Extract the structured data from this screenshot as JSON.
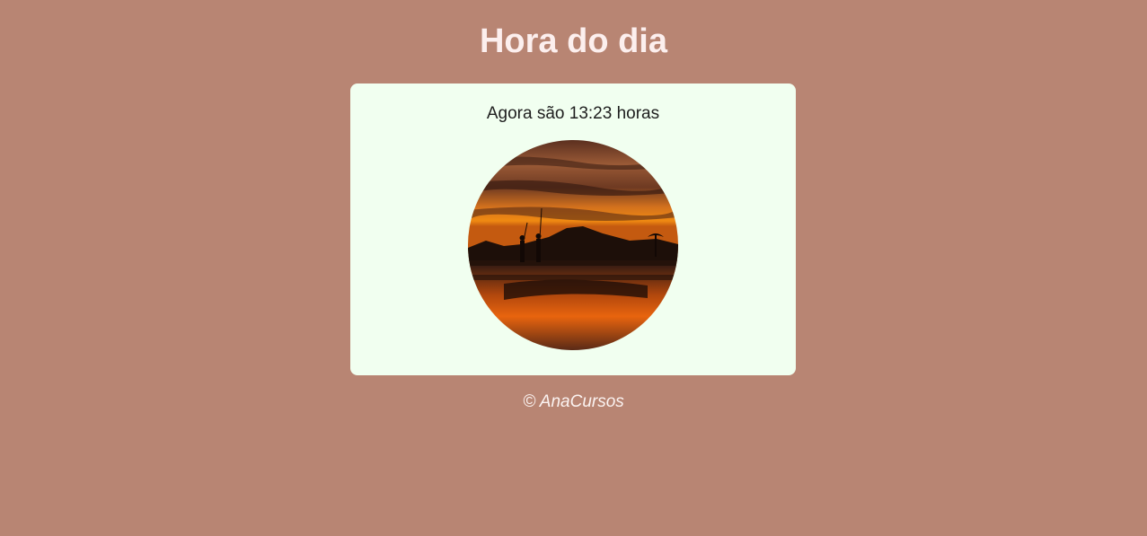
{
  "header": {
    "title": "Hora do dia"
  },
  "card": {
    "time_message": "Agora são 13:23 horas",
    "image_subject": "sunset-beach-fishermen-photo"
  },
  "footer": {
    "copyright": "© AnaCursos"
  },
  "colors": {
    "page_background": "#b88573",
    "card_background": "#f1fff0",
    "title_text": "#fcefee",
    "body_text": "#1e1e1e",
    "footer_text": "#fbf3f1"
  }
}
